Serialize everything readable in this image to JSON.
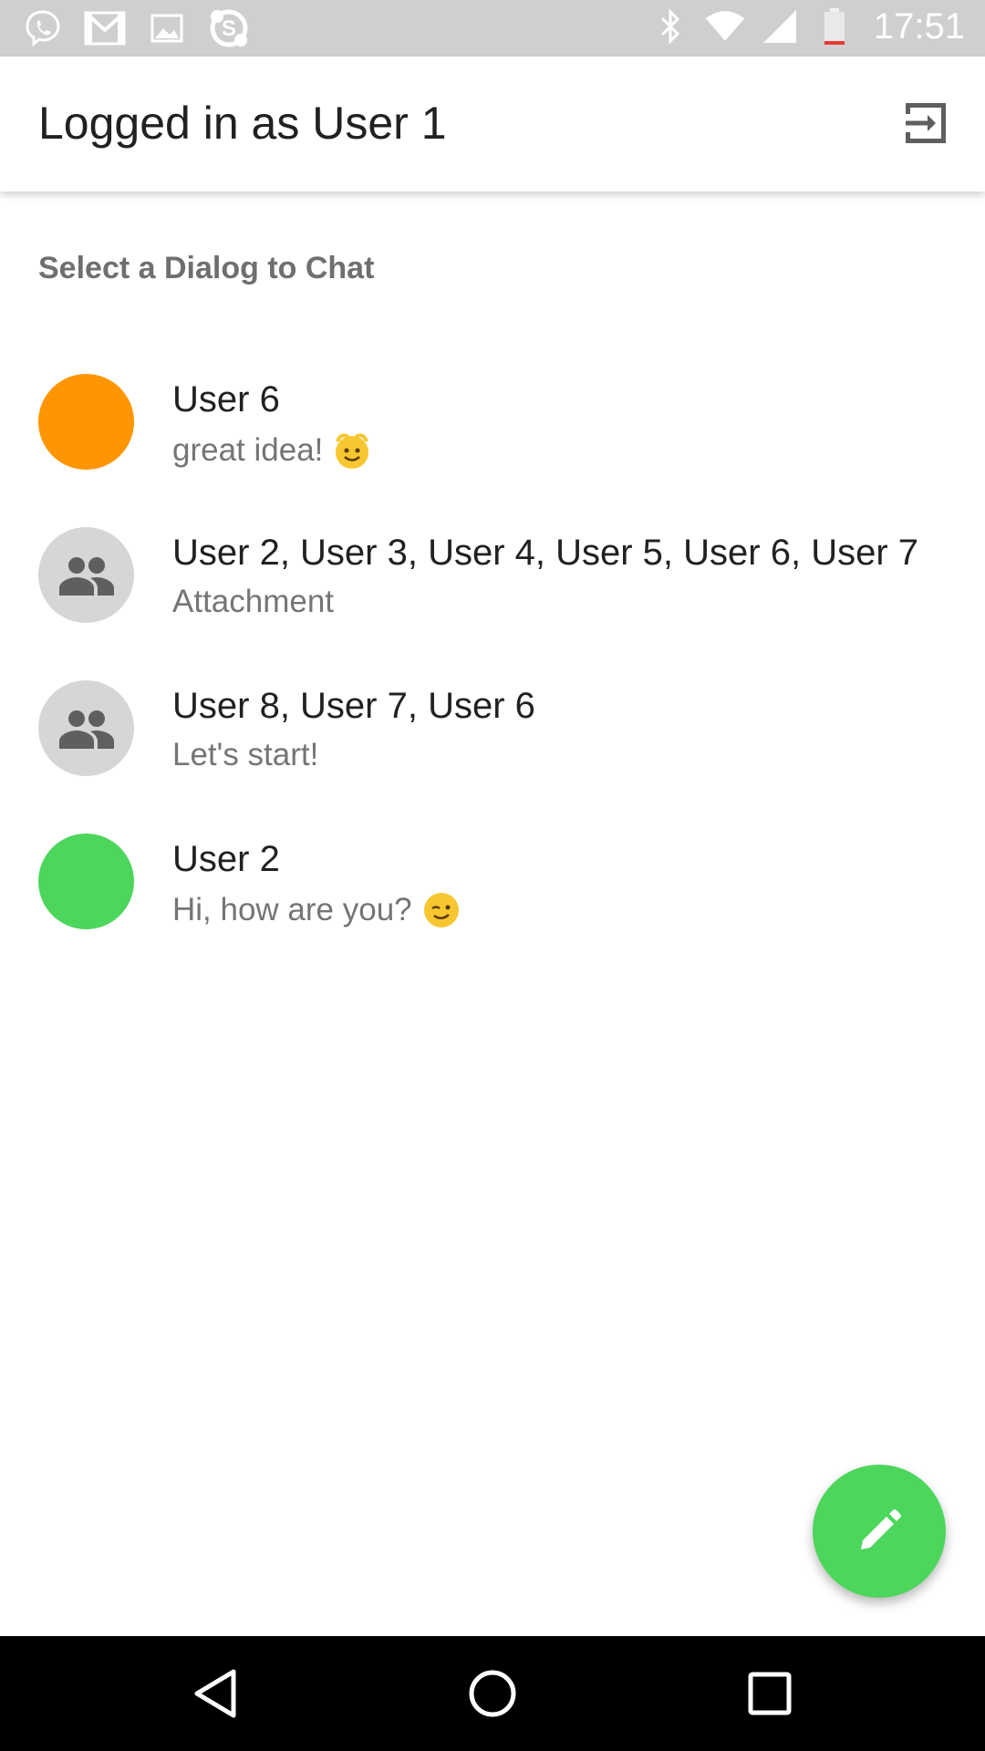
{
  "status_bar": {
    "time": "17:51",
    "left_icons": [
      "viber-icon",
      "gmail-icon",
      "gallery-icon",
      "skype-icon"
    ],
    "right_icons": [
      "bluetooth-icon",
      "wifi-icon",
      "signal-icon",
      "battery-low-icon"
    ]
  },
  "toolbar": {
    "title": "Logged in as User 1",
    "action_icon": "logout-icon"
  },
  "section": {
    "header": "Select a Dialog to Chat"
  },
  "dialogs": [
    {
      "name": "User 6",
      "last_message": "great idea!",
      "emoji": "smiling-face",
      "avatar_type": "color",
      "avatar_color": "#ff9500"
    },
    {
      "name": "User 2, User 3, User 4, User 5, User 6, User 7",
      "last_message": "Attachment",
      "avatar_type": "group",
      "avatar_color": "#d6d6d6"
    },
    {
      "name": "User 8, User 7, User 6",
      "last_message": "Let's start!",
      "avatar_type": "group",
      "avatar_color": "#d6d6d6"
    },
    {
      "name": "User 2",
      "last_message": "Hi, how are you?",
      "emoji": "winking-face",
      "avatar_type": "color",
      "avatar_color": "#4cd65c"
    }
  ],
  "fab": {
    "icon": "pencil-icon",
    "color": "#4cd65c"
  },
  "nav_bar": {
    "buttons": [
      "back-icon",
      "home-icon",
      "recents-icon"
    ]
  },
  "colors": {
    "accent": "#4cd65c",
    "status_bar": "#cfcfcf",
    "text_primary": "#212121",
    "text_secondary": "#757575"
  }
}
